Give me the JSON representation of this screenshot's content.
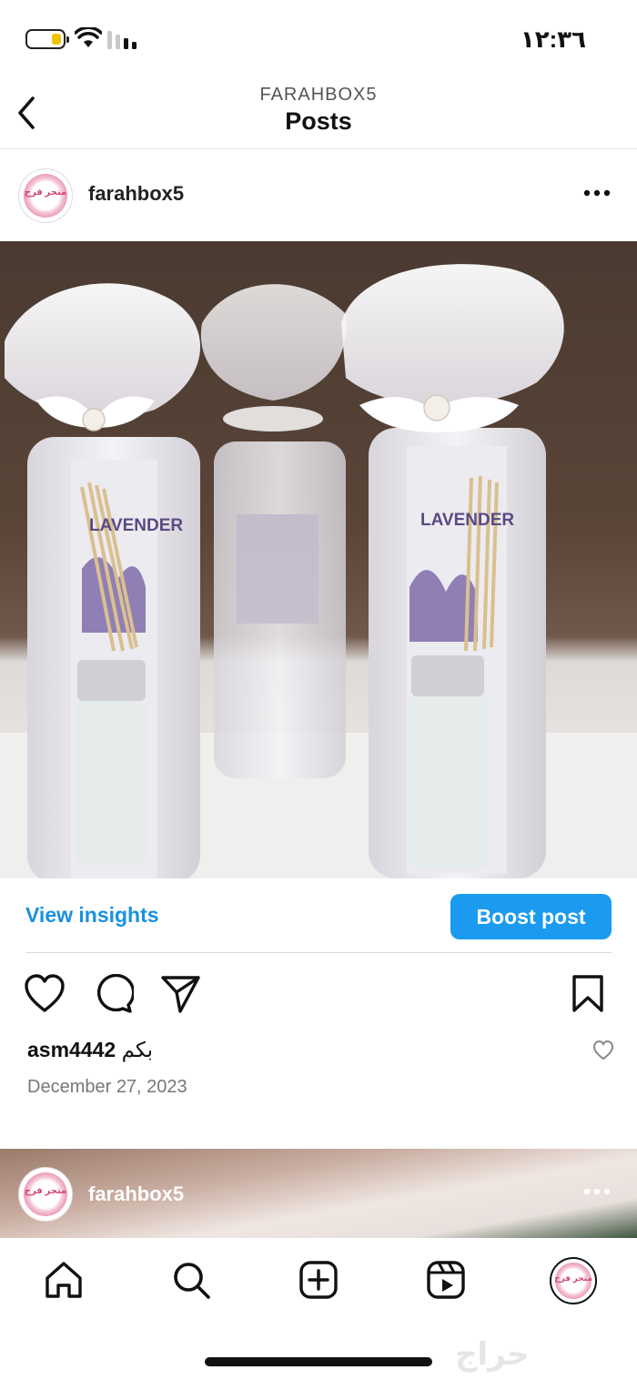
{
  "status_bar": {
    "time": "١٢:٣٦",
    "battery_level": 0.25,
    "battery_color": "#f2c200"
  },
  "header": {
    "username": "FARAHBOX5",
    "title": "Posts"
  },
  "post": {
    "username": "farahbox5",
    "avatar_text": "متجر فرح",
    "view_insights_label": "View insights",
    "boost_label": "Boost post",
    "caption_user": "asm4442",
    "caption_text": "بكم",
    "date": "December 27, 2023",
    "product_label": "LAVENDER"
  },
  "post2": {
    "username": "farahbox5",
    "avatar_text": "متجر فرح"
  },
  "nav": {
    "items": [
      "home-icon",
      "search-icon",
      "create-icon",
      "reels-icon",
      "profile-icon"
    ],
    "profile_avatar_text": "متجر فرح"
  },
  "watermark": "حراج",
  "colors": {
    "accent": "#1a9bf0",
    "link": "#1a90e0"
  }
}
